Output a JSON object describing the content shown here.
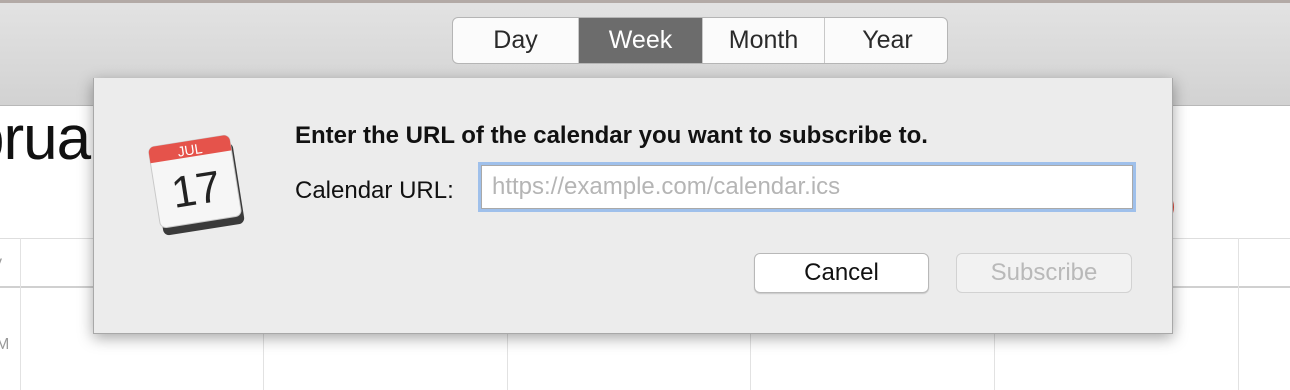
{
  "toolbar": {
    "view_tabs": [
      {
        "label": "Day",
        "active": false
      },
      {
        "label": "Week",
        "active": true
      },
      {
        "label": "Month",
        "active": false
      },
      {
        "label": "Year",
        "active": false
      }
    ]
  },
  "background": {
    "month_title_fragment": "brua",
    "weekday_fragment": "y",
    "time_fragment": "M",
    "accent_color": "#e04a3c"
  },
  "dialog": {
    "icon": {
      "name": "calendar-app-icon",
      "month": "JUL",
      "day": "17"
    },
    "heading": "Enter the URL of the calendar you want to subscribe to.",
    "url_label": "Calendar URL:",
    "url_value": "",
    "url_placeholder": "https://example.com/calendar.ics",
    "cancel_label": "Cancel",
    "subscribe_label": "Subscribe",
    "subscribe_enabled": false,
    "focus_ring_color": "#9fc0eb"
  }
}
